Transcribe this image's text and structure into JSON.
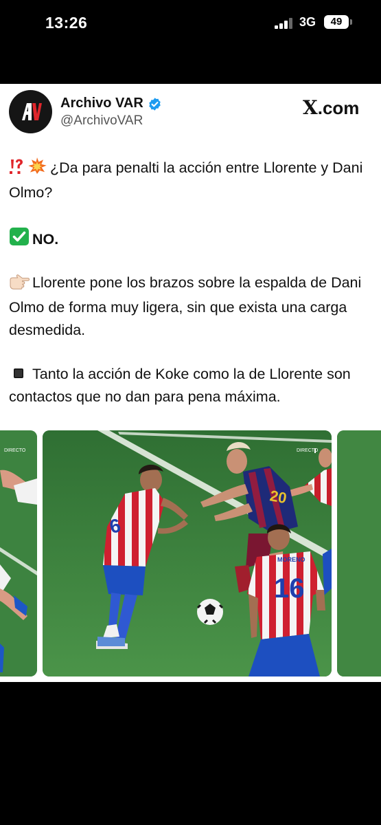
{
  "status_bar": {
    "time": "13:26",
    "network": "3G",
    "battery": "49"
  },
  "tweet": {
    "author_name": "Archivo VAR",
    "author_handle": "@ArchivoVAR",
    "source": "X.com",
    "avatar_letters": "AV",
    "paragraphs": [
      "¿Da para penalti la acción entre Llorente y Dani Olmo?",
      "NO.",
      "Llorente pone los brazos sobre la espalda de Dani Olmo de forma muy ligera, sin que exista una carga desmedida.",
      "Tanto la acción de Koke como la de Llorente son contactos que no dan para pena máxima."
    ],
    "media": {
      "broadcast_tag": "DIRECTO",
      "shirt_number_main": "16",
      "shirt_name": "MORENO",
      "shirt_number_left": "6",
      "shirt_number_barca": "20"
    }
  },
  "colors": {
    "accent_blue": "#1d9bf0",
    "pitch_green": "#3f8540",
    "atletico_red": "#d2232a",
    "barca_blue": "#1e2a78"
  },
  "icons": [
    "signal-icon",
    "battery-icon",
    "verified-icon",
    "interrobang-icon",
    "collision-icon",
    "check-mark-icon",
    "pointing-hand-icon",
    "black-square-icon",
    "soccer-ball-icon"
  ]
}
